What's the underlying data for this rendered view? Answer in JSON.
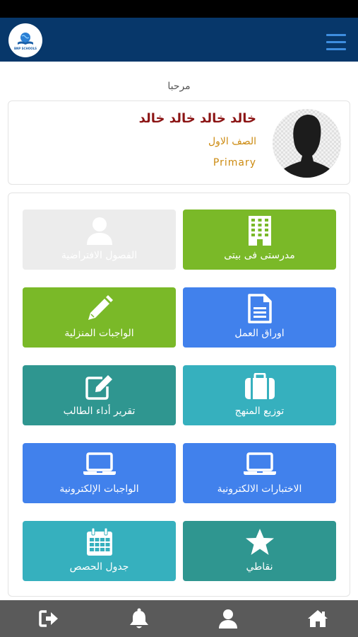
{
  "header": {
    "logo_text": "BNP SCHOOLS",
    "menu_icon": "hamburger-menu-icon",
    "colors": {
      "bar": "#07376a",
      "menu": "#3e8ee0"
    }
  },
  "greeting": "مرحبا",
  "profile": {
    "name": "خالد خالد خالد خالد",
    "grade": "الصف الاول",
    "stage": "Primary",
    "avatar_icon": "user-silhouette-icon",
    "colors": {
      "name": "#8b1414",
      "details": "#cc8a10"
    }
  },
  "tiles": [
    {
      "label": "مدرستى فى بيتى",
      "icon": "building-icon",
      "color": "#7ab928"
    },
    {
      "label": "الفصول الافتراضية",
      "icon": "user-icon",
      "color": "#ececec",
      "disabled": true
    },
    {
      "label": "اوراق العمل",
      "icon": "document-icon",
      "color": "#4181ec"
    },
    {
      "label": "الواجبات المنزلية",
      "icon": "pencil-icon",
      "color": "#7ab928"
    },
    {
      "label": "توزيع المنهج",
      "icon": "briefcase-icon",
      "color": "#36b0be"
    },
    {
      "label": "تقرير أداء الطالب",
      "icon": "edit-icon",
      "color": "#2f9690"
    },
    {
      "label": "الاختبارات الالكترونية",
      "icon": "laptop-icon",
      "color": "#4181ec"
    },
    {
      "label": "الواجبات الإلكترونية",
      "icon": "laptop-icon",
      "color": "#4181ec"
    },
    {
      "label": "نقاطي",
      "icon": "star-icon",
      "color": "#2f9690"
    },
    {
      "label": "جدول الحصص",
      "icon": "calendar-icon",
      "color": "#36b0be"
    }
  ],
  "bottom_nav": {
    "items": [
      {
        "icon": "logout-icon"
      },
      {
        "icon": "bell-icon"
      },
      {
        "icon": "profile-icon"
      },
      {
        "icon": "home-icon"
      }
    ],
    "colors": {
      "bar": "#5a5a5a",
      "icon": "#ffffff"
    }
  }
}
